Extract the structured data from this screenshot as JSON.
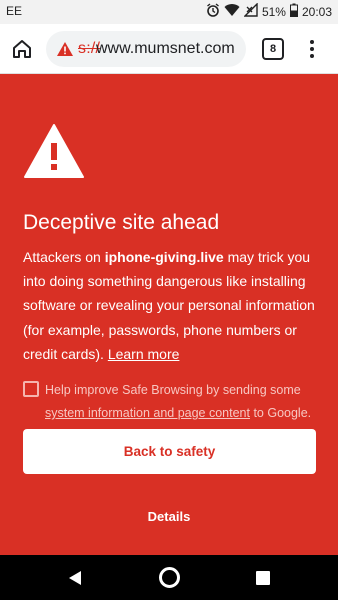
{
  "status_bar": {
    "carrier": "EE",
    "battery": "51%",
    "time": "20:03",
    "icons": [
      "alarm-icon",
      "wifi-icon",
      "cellular-no-signal-icon",
      "battery-icon"
    ]
  },
  "toolbar": {
    "url_scheme_fragment": "s://",
    "url_host": "www.mumsnet.com",
    "tab_count": "8",
    "icons": [
      "home-icon",
      "not-secure-warning-icon",
      "more-vert-icon"
    ]
  },
  "interstitial": {
    "title": "Deceptive site ahead",
    "body_prefix": "Attackers on ",
    "domain": "iphone-giving.live",
    "body_rest": " may trick you into doing something dangerous like installing software or revealing your personal information (for example, passwords, phone numbers or credit cards). ",
    "learn_more": "Learn more",
    "safe_browsing_text": "Help improve Safe Browsing by sending some ",
    "safe_browsing_link": "system information and page content",
    "safe_browsing_suffix": " to Google.",
    "checkbox_checked": false,
    "primary_button": "Back to safety",
    "secondary_button": "Details"
  },
  "colors": {
    "background": "#d93025",
    "primary_button_bg": "#ffffff",
    "primary_button_text": "#d93025",
    "text": "#ffffff"
  },
  "nav_bar": {
    "icons": [
      "back-triangle-icon",
      "home-circle-icon",
      "recents-square-icon"
    ]
  }
}
